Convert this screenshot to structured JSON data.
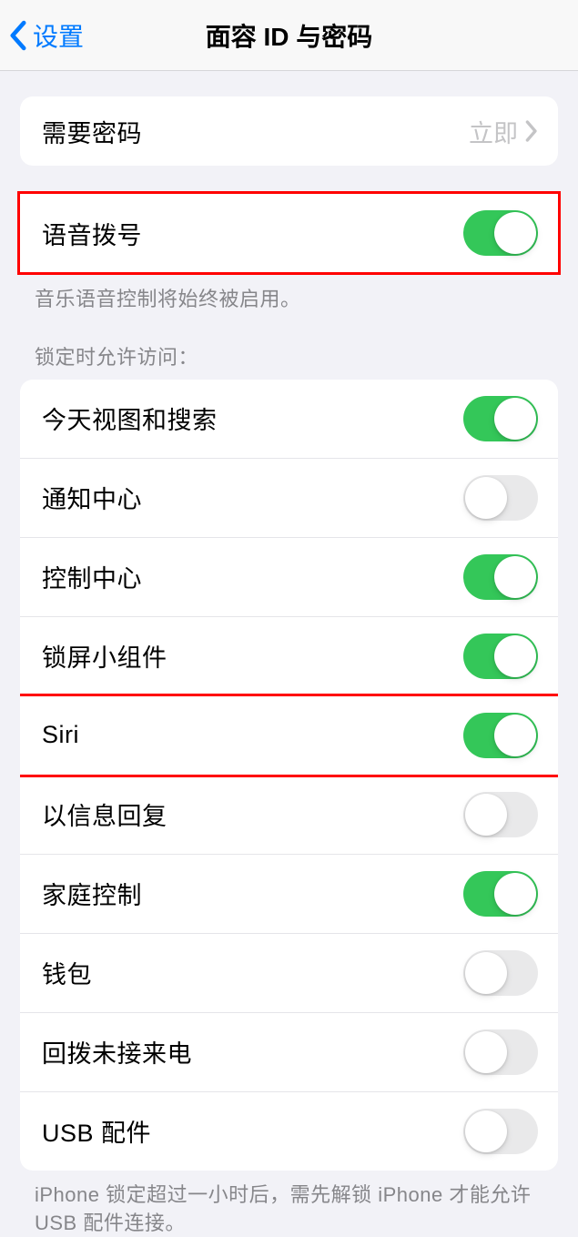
{
  "nav": {
    "back_label": "设置",
    "title": "面容 ID 与密码"
  },
  "require_passcode": {
    "label": "需要密码",
    "value": "立即"
  },
  "voice_dial": {
    "label": "语音拨号",
    "footer": "音乐语音控制将始终被启用。"
  },
  "allow_access_header": "锁定时允许访问：",
  "items": [
    {
      "label": "今天视图和搜索",
      "on": true
    },
    {
      "label": "通知中心",
      "on": false
    },
    {
      "label": "控制中心",
      "on": true
    },
    {
      "label": "锁屏小组件",
      "on": true
    },
    {
      "label": "Siri",
      "on": true
    },
    {
      "label": "以信息回复",
      "on": false
    },
    {
      "label": "家庭控制",
      "on": true
    },
    {
      "label": "钱包",
      "on": false
    },
    {
      "label": "回拨未接来电",
      "on": false
    },
    {
      "label": "USB 配件",
      "on": false
    }
  ],
  "usb_footer": "iPhone 锁定超过一小时后，需先解锁 iPhone 才能允许USB 配件连接。"
}
